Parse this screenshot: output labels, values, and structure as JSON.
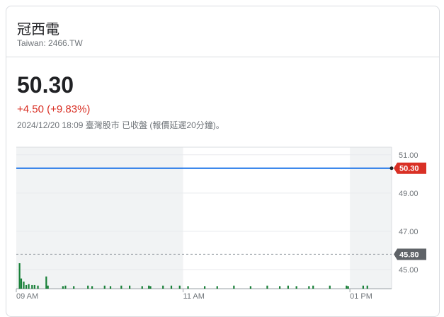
{
  "company": {
    "name": "冠西電",
    "ticker_line": "Taiwan: 2466.TW"
  },
  "quote": {
    "price": "50.30",
    "change": "+4.50 (+9.83%)",
    "timestamp": "2024/12/20 18:09 臺灣股市 已收盤 (報價延遲20分鐘)。"
  },
  "colors": {
    "price_line": "#1a73e8",
    "volume": "#188038",
    "down": "#d93025",
    "prev_close_badge": "#5f6368",
    "shade": "#f1f3f4"
  },
  "chart_data": {
    "type": "line",
    "ylim": [
      44,
      51.4
    ],
    "y_ticks": [
      "51.00",
      "49.00",
      "47.00",
      "45.00"
    ],
    "x_ticks": [
      "09 AM",
      "11 AM",
      "01 PM"
    ],
    "current_price": {
      "label": "50.30",
      "value": 50.3
    },
    "previous_close": {
      "label": "45.80",
      "value": 45.8
    },
    "series": [
      {
        "x": [
          9.0,
          13.5
        ],
        "values": [
          50.3,
          50.3
        ]
      }
    ],
    "volume": {
      "times": [
        9.03,
        9.05,
        9.08,
        9.11,
        9.14,
        9.18,
        9.21,
        9.25,
        9.35,
        9.37,
        9.55,
        9.58,
        9.68,
        9.85,
        9.9,
        10.05,
        10.12,
        10.25,
        10.35,
        10.5,
        10.58,
        10.6,
        10.75,
        10.85,
        10.95,
        11.05,
        11.25,
        11.4,
        11.6,
        11.8,
        12.0,
        12.15,
        12.25,
        12.35,
        12.5,
        12.55,
        12.75,
        12.95,
        12.97,
        13.15,
        13.2
      ],
      "values": [
        100,
        40,
        28,
        14,
        18,
        14,
        14,
        12,
        48,
        12,
        10,
        12,
        10,
        12,
        10,
        12,
        10,
        12,
        12,
        10,
        12,
        10,
        12,
        12,
        12,
        10,
        10,
        10,
        12,
        10,
        12,
        10,
        12,
        10,
        10,
        12,
        12,
        12,
        10,
        12,
        12
      ]
    }
  }
}
